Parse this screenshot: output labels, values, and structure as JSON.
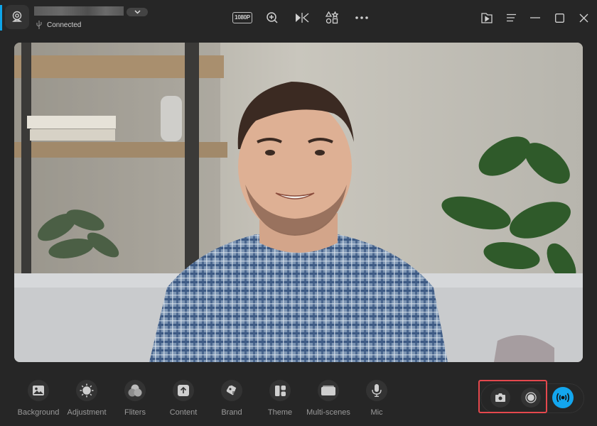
{
  "titlebar": {
    "device_name_redacted": "",
    "status_text": "Connected",
    "status_icon": "usb-icon",
    "center_tools": [
      {
        "name": "resolution-button",
        "label": "1080P",
        "icon": "resolution-badge"
      },
      {
        "name": "zoom-in-button",
        "icon": "zoom-in-icon"
      },
      {
        "name": "mirror-button",
        "icon": "mirror-flip-icon"
      },
      {
        "name": "shapes-button",
        "icon": "shapes-icon"
      },
      {
        "name": "more-button",
        "icon": "more-horizontal-icon"
      }
    ],
    "right_tools": [
      {
        "name": "recordings-folder-button",
        "icon": "folder-play-icon"
      },
      {
        "name": "menu-button",
        "icon": "menu-icon"
      },
      {
        "name": "minimize-button",
        "icon": "minimize-icon"
      },
      {
        "name": "maximize-button",
        "icon": "maximize-icon"
      },
      {
        "name": "close-button",
        "icon": "close-icon"
      }
    ]
  },
  "preview": {
    "description": "Live camera preview of a smiling man in a plaid shirt on a sofa"
  },
  "toolbar": {
    "items": [
      {
        "label": "Background",
        "icon": "image-icon"
      },
      {
        "label": "Adjustment",
        "icon": "sun-icon"
      },
      {
        "label": "Fliters",
        "icon": "filters-icon"
      },
      {
        "label": "Content",
        "icon": "upload-icon"
      },
      {
        "label": "Brand",
        "icon": "tag-icon"
      },
      {
        "label": "Theme",
        "icon": "layout-icon"
      },
      {
        "label": "Multi-scenes",
        "icon": "scenes-icon"
      },
      {
        "label": "Mic",
        "icon": "mic-icon"
      }
    ]
  },
  "capture": {
    "snapshot_icon": "camera-icon",
    "record_icon": "record-icon",
    "live_icon": "broadcast-icon",
    "highlight_color": "#e5484d",
    "live_color": "#13a6ee"
  },
  "colors": {
    "background": "#262626",
    "accent": "#0ea5e9"
  }
}
